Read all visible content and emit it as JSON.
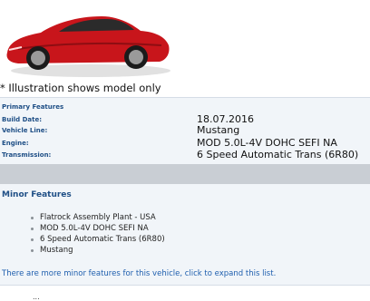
{
  "caption": "* Illustration shows model only",
  "primary": {
    "title": "Primary Features",
    "rows": [
      {
        "label": "Build Date:",
        "value": "18.07.2016"
      },
      {
        "label": "Vehicle Line:",
        "value": "Mustang"
      },
      {
        "label": "Engine:",
        "value": "MOD 5.0L-4V DOHC SEFI NA"
      },
      {
        "label": "Transmission:",
        "value": "6 Speed Automatic Trans (6R80)"
      }
    ]
  },
  "minor": {
    "title": "Minor Features",
    "items": [
      "Flatrock Assembly Plant - USA",
      "MOD 5.0L-4V DOHC SEFI NA",
      "6 Speed Automatic Trans (6R80)",
      "Mustang"
    ],
    "expand_text": "There are more minor features for this vehicle, click to expand this list."
  },
  "partial_text": "...",
  "colors": {
    "car_body": "#c8151b",
    "label_blue": "#1f4f86",
    "link_blue": "#1f5fae",
    "panel_bg": "#f1f5f9",
    "band_grey": "#c9ced4"
  }
}
